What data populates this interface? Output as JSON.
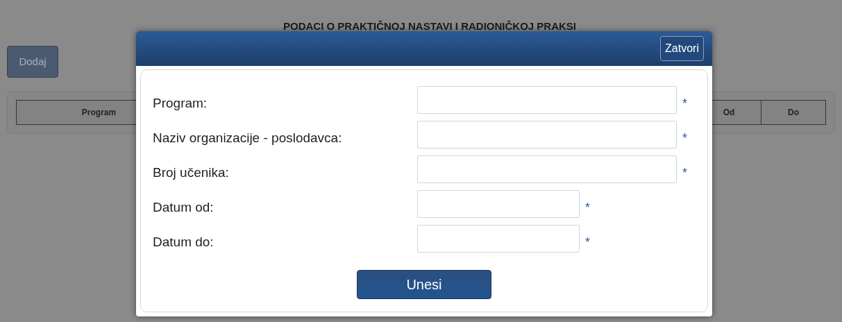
{
  "page": {
    "title": "PODACI O PRAKTIČNOJ NASTAVI I RADIONIČKOJ PRAKSI",
    "add_button": "Dodaj",
    "table": {
      "columns": [
        {
          "label": "Program",
          "kind": "wide"
        },
        {
          "label": "Od",
          "kind": "narrow"
        },
        {
          "label": "Do",
          "kind": "narrow"
        }
      ]
    }
  },
  "dialog": {
    "close_button": "Zatvori",
    "fields": [
      {
        "label": "Program:",
        "kind": "wide",
        "required": true
      },
      {
        "label": "Naziv organizacije - poslodavca:",
        "kind": "wide",
        "required": true
      },
      {
        "label": "Broj učenika:",
        "kind": "wide",
        "required": true
      },
      {
        "label": "Datum od:",
        "kind": "short",
        "required": true
      },
      {
        "label": "Datum do:",
        "kind": "short",
        "required": true
      }
    ],
    "required_mark": "*",
    "submit_button": "Unesi"
  }
}
